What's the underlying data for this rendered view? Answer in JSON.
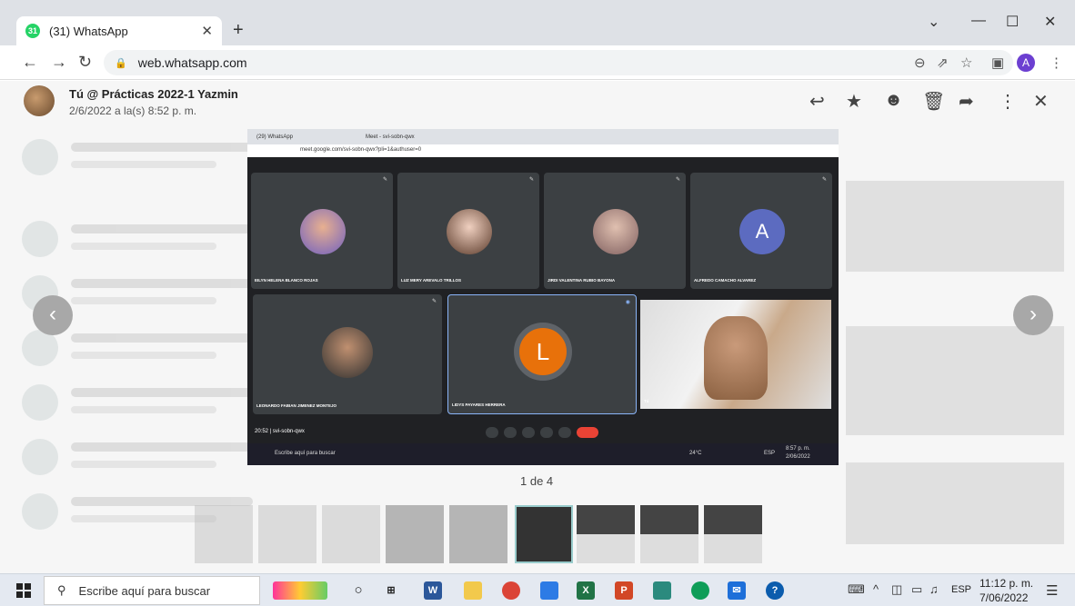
{
  "browser": {
    "tab_title": "(31) WhatsApp",
    "tab_badge": "31",
    "url": "web.whatsapp.com"
  },
  "viewer": {
    "sender": "Tú @ Prácticas 2022-1 Yazmin",
    "timestamp": "2/6/2022 a la(s) 8:52 p. m.",
    "counter": "1 de 4"
  },
  "screenshot": {
    "tab1": "(29) WhatsApp",
    "tab2": "Meet - svi-sobn-qwx",
    "url": "meet.google.com/svi-sobn-qwx?pli=1&authuser=0",
    "participants": [
      {
        "name": "EILYN HELENA BLANCO ROJAS"
      },
      {
        "name": "LUZ MERY AREVALO TRILLOS"
      },
      {
        "name": "JIRDI VALENTINA RUBIO BAYONA"
      },
      {
        "name": "ALFREDO CAMACHO ALVAREZ",
        "initial": "A"
      },
      {
        "name": "LEONARDO FABIAN JIMENEZ MONTEJO"
      },
      {
        "name": "LIDYS PAYARES HERRERA",
        "initial": "L"
      },
      {
        "name": "Tú"
      }
    ],
    "meeting_info": "20:52 | svi-sobn-qwx",
    "taskbar_search": "Escribe aquí para buscar",
    "weather": "24°C",
    "lang": "ESP",
    "clock_time": "8:57 p. m.",
    "clock_date": "2/06/2022"
  },
  "taskbar": {
    "search_placeholder": "Escribe aquí para buscar",
    "lang": "ESP",
    "time": "11:12 p. m.",
    "date": "7/06/2022"
  }
}
